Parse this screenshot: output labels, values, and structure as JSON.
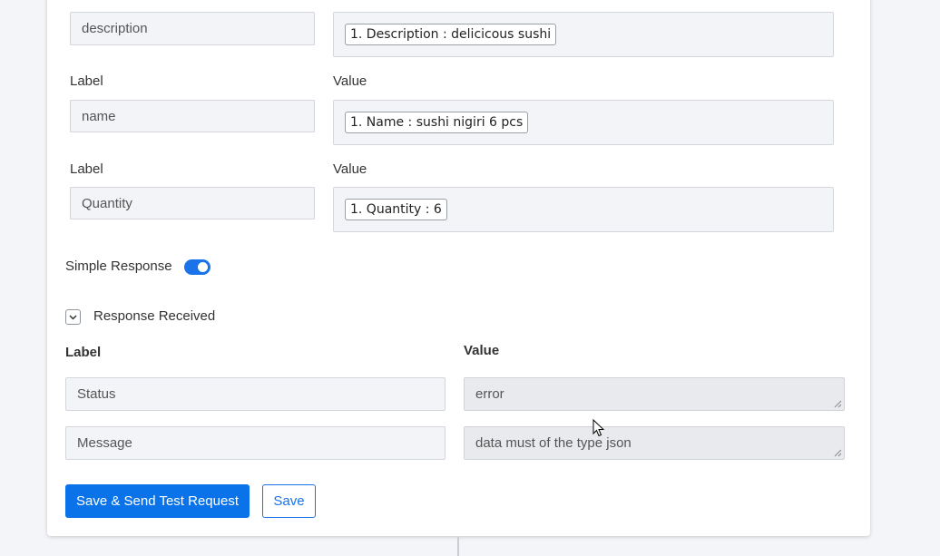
{
  "mappings": [
    {
      "label_caption": "",
      "value_caption": "",
      "label": "description",
      "value_chip": "1. Description : delicicous sushi"
    },
    {
      "label_caption": "Label",
      "value_caption": "Value",
      "label": "name",
      "value_chip": "1. Name : sushi nigiri 6 pcs"
    },
    {
      "label_caption": "Label",
      "value_caption": "Value",
      "label": "Quantity",
      "value_chip": "1. Quantity : 6"
    }
  ],
  "simple_response": {
    "label": "Simple Response",
    "enabled": true
  },
  "response_received": {
    "title": "Response Received",
    "label_header": "Label",
    "value_header": "Value",
    "rows": [
      {
        "label": "Status",
        "value": "error"
      },
      {
        "label": "Message",
        "value": "data must of the type json"
      }
    ]
  },
  "buttons": {
    "save_send": "Save & Send Test Request",
    "save": "Save"
  },
  "colors": {
    "accent": "#0b73ea",
    "field_bg": "#f2f4f7",
    "readonly_bg": "#e8eaed"
  }
}
